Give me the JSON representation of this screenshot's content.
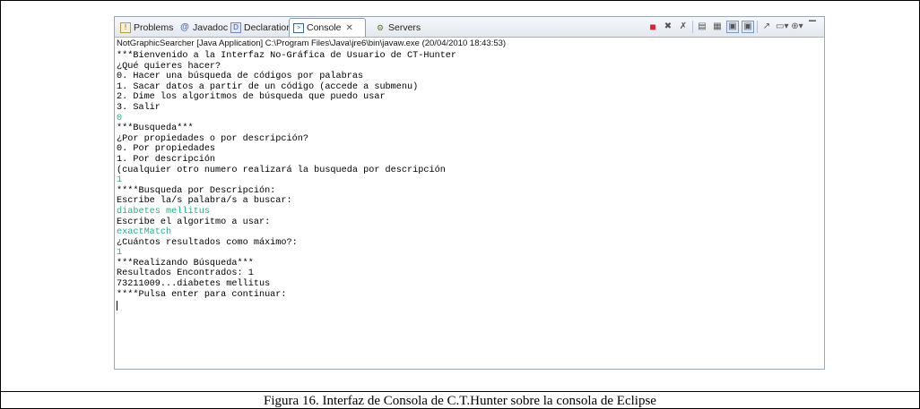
{
  "tabs": [
    {
      "label": "Problems",
      "icon": "problems-icon"
    },
    {
      "label": "Javadoc",
      "icon": "javadoc-icon"
    },
    {
      "label": "Declaration",
      "icon": "declaration-icon"
    },
    {
      "label": "Console",
      "icon": "console-icon",
      "active": true
    },
    {
      "label": "Servers",
      "icon": "servers-icon"
    }
  ],
  "toolbar_icons": [
    "terminate-icon",
    "remove-launch-icon",
    "remove-all-terminated-icon",
    "clear-console-icon",
    "scroll-lock-icon",
    "pin-console-icon",
    "show-when-stdout-icon",
    "open-console-icon",
    "display-selected-console-icon",
    "new-console-icon",
    "minimize-icon"
  ],
  "console_path": "NotGraphicSearcher [Java Application] C:\\Program Files\\Java\\jre6\\bin\\javaw.exe (20/04/2010 18:43:53)",
  "console_lines": [
    {
      "text": "***Bienvenido a la Interfaz No-Gráfica de Usuario de CT-Hunter",
      "input": false
    },
    {
      "text": "¿Qué quieres hacer?",
      "input": false
    },
    {
      "text": "0. Hacer una búsqueda de códigos por palabras",
      "input": false
    },
    {
      "text": "1. Sacar datos a partir de un código (accede a submenu)",
      "input": false
    },
    {
      "text": "2. Dime los algoritmos de búsqueda que puedo usar",
      "input": false
    },
    {
      "text": "3. Salir",
      "input": false
    },
    {
      "text": "0",
      "input": true
    },
    {
      "text": "***Busqueda***",
      "input": false
    },
    {
      "text": "¿Por propiedades o por descripción?",
      "input": false
    },
    {
      "text": "0. Por propiedades",
      "input": false
    },
    {
      "text": "1. Por descripción",
      "input": false
    },
    {
      "text": "(cualquier otro numero realizará la busqueda por descripción",
      "input": false
    },
    {
      "text": "1",
      "input": true
    },
    {
      "text": "****Busqueda por Descripción:",
      "input": false
    },
    {
      "text": "Escribe la/s palabra/s a buscar:",
      "input": false
    },
    {
      "text": "diabetes mellitus",
      "input": true
    },
    {
      "text": "Escribe el algoritmo a usar:",
      "input": false
    },
    {
      "text": "exactMatch",
      "input": true
    },
    {
      "text": "¿Cuántos resultados como máximo?:",
      "input": false
    },
    {
      "text": "1",
      "input": true
    },
    {
      "text": "***Realizando Búsqueda***",
      "input": false
    },
    {
      "text": "Resultados Encontrados: 1",
      "input": false
    },
    {
      "text": "73211009...diabetes mellitus",
      "input": false
    },
    {
      "text": "****Pulsa enter para continuar:",
      "input": false
    }
  ],
  "colors": {
    "input_text": "#1ab48c",
    "terminate": "#d9232e"
  },
  "caption": "Figura 16. Interfaz de Consola de C.T.Hunter sobre la consola de Eclipse"
}
